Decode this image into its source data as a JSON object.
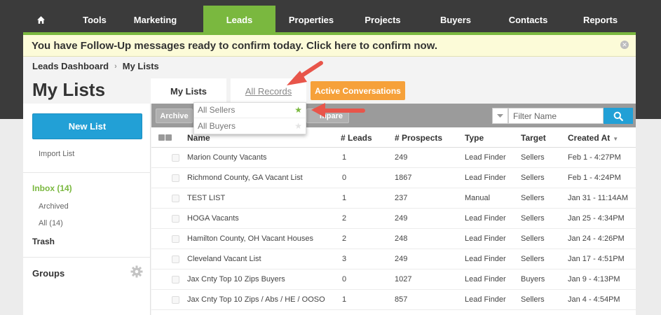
{
  "nav": {
    "items": [
      {
        "id": "home",
        "label": "",
        "icon": "home-icon"
      },
      {
        "id": "tools",
        "label": "Tools"
      },
      {
        "id": "marketing",
        "label": "Marketing"
      },
      {
        "id": "leads",
        "label": "Leads",
        "active": true
      },
      {
        "id": "properties",
        "label": "Properties"
      },
      {
        "id": "projects",
        "label": "Projects"
      },
      {
        "id": "buyers",
        "label": "Buyers"
      },
      {
        "id": "contacts",
        "label": "Contacts"
      },
      {
        "id": "reports",
        "label": "Reports"
      }
    ]
  },
  "banner": {
    "text": "You have Follow-Up messages ready to confirm today. Click here to confirm now.",
    "close_icon": "close-icon"
  },
  "breadcrumb": {
    "root": "Leads Dashboard",
    "separator": "›",
    "current": "My Lists"
  },
  "page_title": "My Lists",
  "tabs": {
    "my_lists": "My Lists",
    "all_records": "All Records",
    "active_conversations": "Active Conversations"
  },
  "sidebar": {
    "new_list": "New List",
    "import_list": "Import List",
    "inbox": "Inbox (14)",
    "archived": "Archived",
    "all": "All (14)",
    "trash": "Trash",
    "groups": "Groups",
    "gear_icon": "gear-icon"
  },
  "toolbar": {
    "archive": "Archive",
    "compare": "mpare",
    "filter_placeholder": "Filter Name",
    "search_icon": "search-icon"
  },
  "dropdown": {
    "items": [
      {
        "label": "All Sellers",
        "starred": true
      },
      {
        "label": "All Buyers",
        "starred": false
      }
    ]
  },
  "table": {
    "columns": {
      "name": "Name",
      "leads": "# Leads",
      "prospects": "# Prospects",
      "type": "Type",
      "target": "Target",
      "created": "Created At"
    },
    "rows": [
      {
        "name": "Marion County Vacants",
        "leads": "1",
        "prospects": "249",
        "type": "Lead Finder",
        "target": "Sellers",
        "created": "Feb 1 - 4:27PM"
      },
      {
        "name": "Richmond County, GA Vacant List",
        "leads": "0",
        "prospects": "1867",
        "type": "Lead Finder",
        "target": "Sellers",
        "created": "Feb 1 - 4:24PM"
      },
      {
        "name": "TEST LIST",
        "leads": "1",
        "prospects": "237",
        "type": "Manual",
        "target": "Sellers",
        "created": "Jan 31 - 11:14AM"
      },
      {
        "name": "HOGA Vacants",
        "leads": "2",
        "prospects": "249",
        "type": "Lead Finder",
        "target": "Sellers",
        "created": "Jan 25 - 4:34PM"
      },
      {
        "name": "Hamilton County, OH Vacant Houses",
        "leads": "2",
        "prospects": "248",
        "type": "Lead Finder",
        "target": "Sellers",
        "created": "Jan 24 - 4:26PM"
      },
      {
        "name": "Cleveland Vacant List",
        "leads": "3",
        "prospects": "249",
        "type": "Lead Finder",
        "target": "Sellers",
        "created": "Jan 17 - 4:51PM"
      },
      {
        "name": "Jax Cnty Top 10 Zips Buyers",
        "leads": "0",
        "prospects": "1027",
        "type": "Lead Finder",
        "target": "Buyers",
        "created": "Jan 9 - 4:13PM"
      },
      {
        "name": "Jax Cnty Top 10 Zips / Abs / HE / OOSO",
        "leads": "1",
        "prospects": "857",
        "type": "Lead Finder",
        "target": "Sellers",
        "created": "Jan 4 - 4:54PM"
      }
    ]
  },
  "colors": {
    "brand_green": "#7ab83f",
    "accent_blue": "#22a0d6",
    "accent_orange": "#f6a13a",
    "annotation_red": "#e8554a",
    "nav_bg": "#3b3b3b"
  }
}
